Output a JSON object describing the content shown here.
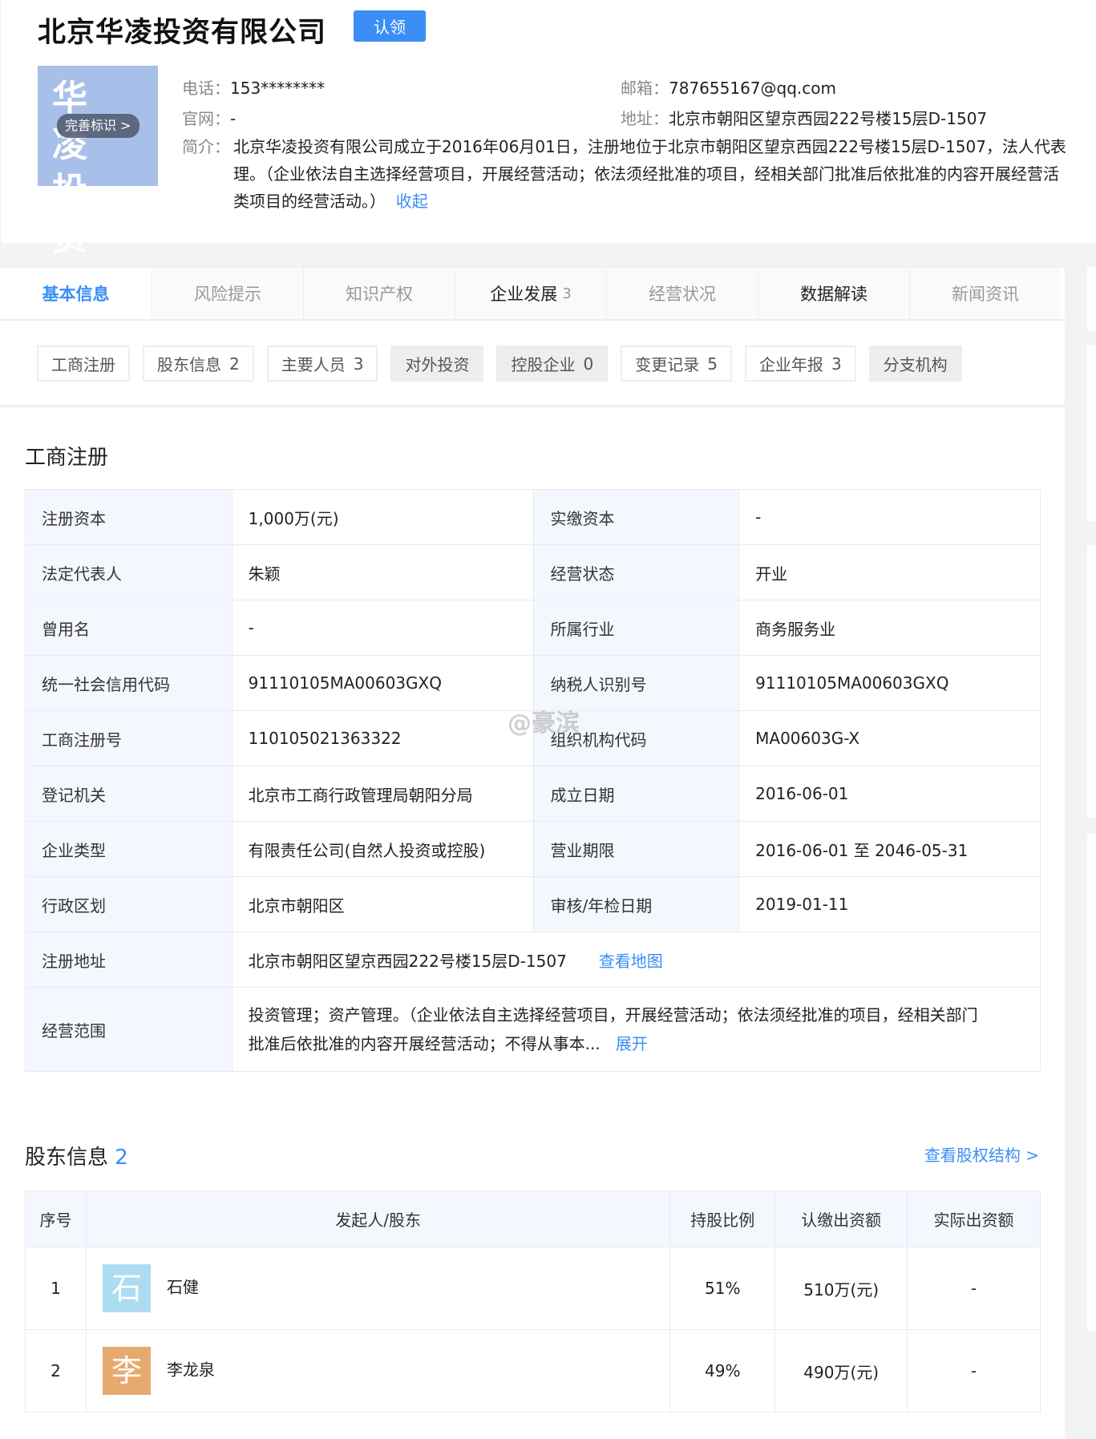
{
  "company": {
    "name": "北京华凌投资有限公司",
    "claim_label": "认领",
    "logo_text": [
      "华 凌",
      "投 资"
    ],
    "logo_badge": "完善标识 >",
    "logo_color": "#a3bde8"
  },
  "contact": {
    "phone_label": "电话：",
    "phone": "153********",
    "email_label": "邮箱：",
    "email": "787655167@qq.com",
    "site_label": "官网：",
    "site": "-",
    "addr_label": "地址：",
    "addr": "北京市朝阳区望京西园222号楼15层D-1507",
    "intro_label": "简介：",
    "intro_lines": [
      "北京华凌投资有限公司成立于2016年06月01日，注册地位于北京市朝阳区望京西园222号楼15层D-1507，法人代表",
      "理。（企业依法自主选择经营项目，开展经营活动；依法须经批准的项目，经相关部门批准后依批准的内容开展经营活",
      "类项目的经营活动。）"
    ],
    "collapse": "收起"
  },
  "tabs": [
    {
      "label": "基本信息"
    },
    {
      "label": "风险提示"
    },
    {
      "label": "知识产权"
    },
    {
      "label": "企业发展",
      "count": "3"
    },
    {
      "label": "经营状况"
    },
    {
      "label": "数据解读"
    },
    {
      "label": "新闻资讯"
    }
  ],
  "subtabs": [
    {
      "label": "工商注册"
    },
    {
      "label": "股东信息",
      "count": "2"
    },
    {
      "label": "主要人员",
      "count": "3"
    },
    {
      "label": "对外投资"
    },
    {
      "label": "控股企业",
      "count": "0"
    },
    {
      "label": "变更记录",
      "count": "5"
    },
    {
      "label": "企业年报",
      "count": "3"
    },
    {
      "label": "分支机构"
    }
  ],
  "registration": {
    "title": "工商注册",
    "rows": [
      [
        "注册资本",
        "1,000万(元)",
        "实缴资本",
        "-"
      ],
      [
        "法定代表人",
        "朱颖",
        "经营状态",
        "开业"
      ],
      [
        "曾用名",
        "-",
        "所属行业",
        "商务服务业"
      ],
      [
        "统一社会信用代码",
        "91110105MA00603GXQ",
        "纳税人识别号",
        "91110105MA00603GXQ"
      ],
      [
        "工商注册号",
        "110105021363322",
        "组织机构代码",
        "MA00603G-X"
      ],
      [
        "登记机关",
        "北京市工商行政管理局朝阳分局",
        "成立日期",
        "2016-06-01"
      ],
      [
        "企业类型",
        "有限责任公司(自然人投资或控股)",
        "营业期限",
        "2016-06-01 至 2046-05-31"
      ],
      [
        "行政区划",
        "北京市朝阳区",
        "审核/年检日期",
        "2019-01-11"
      ]
    ],
    "address_label": "注册地址",
    "address": "北京市朝阳区望京西园222号楼15层D-1507",
    "map_link": "查看地图",
    "scope_label": "经营范围",
    "scope_lines": [
      "投资管理；资产管理。（企业依法自主选择经营项目，开展经营活动；依法须经批准的项目，经相关部门",
      "批准后依批准的内容开展经营活动；不得从事本..."
    ],
    "expand": "展开"
  },
  "shareholders": {
    "title": "股东信息",
    "count": "2",
    "structure_link": "查看股权结构 >",
    "headers": [
      "序号",
      "发起人/股东",
      "持股比例",
      "认缴出资额",
      "实际出资额"
    ],
    "rows": [
      {
        "no": "1",
        "avatar": "石",
        "avatar_color": "#addcf2",
        "name": "石健",
        "ratio": "51%",
        "subscribed": "510万(元)",
        "actual": "-"
      },
      {
        "no": "2",
        "avatar": "李",
        "avatar_color": "#e6aa6e",
        "name": "李龙泉",
        "ratio": "49%",
        "subscribed": "490万(元)",
        "actual": "-"
      }
    ]
  },
  "watermark": "@豪滨"
}
